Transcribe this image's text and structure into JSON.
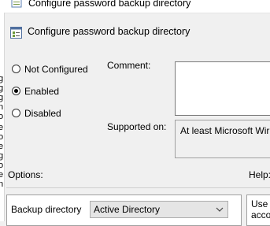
{
  "window": {
    "title": "Configure password backup directory"
  },
  "header": {
    "title": "Configure password backup directory",
    "icon": "policy-setting-icon"
  },
  "state": {
    "options": [
      {
        "label": "Not Configured",
        "checked": false
      },
      {
        "label": "Enabled",
        "checked": true
      },
      {
        "label": "Disabled",
        "checked": false
      }
    ]
  },
  "comment": {
    "label": "Comment:",
    "value": ""
  },
  "supported": {
    "label": "Supported on:",
    "value": "At least Microsoft Wir"
  },
  "sections": {
    "options_label": "Options:",
    "help_label": "Help:"
  },
  "backup_directory": {
    "label": "Backup directory",
    "selected": "Active Directory"
  },
  "help": {
    "lines": [
      "Use t",
      "acco"
    ]
  },
  "left_fragments": [
    "g",
    "g",
    "g",
    "n",
    "o",
    "e",
    "o",
    "e",
    "g",
    "o",
    "e",
    "n"
  ]
}
